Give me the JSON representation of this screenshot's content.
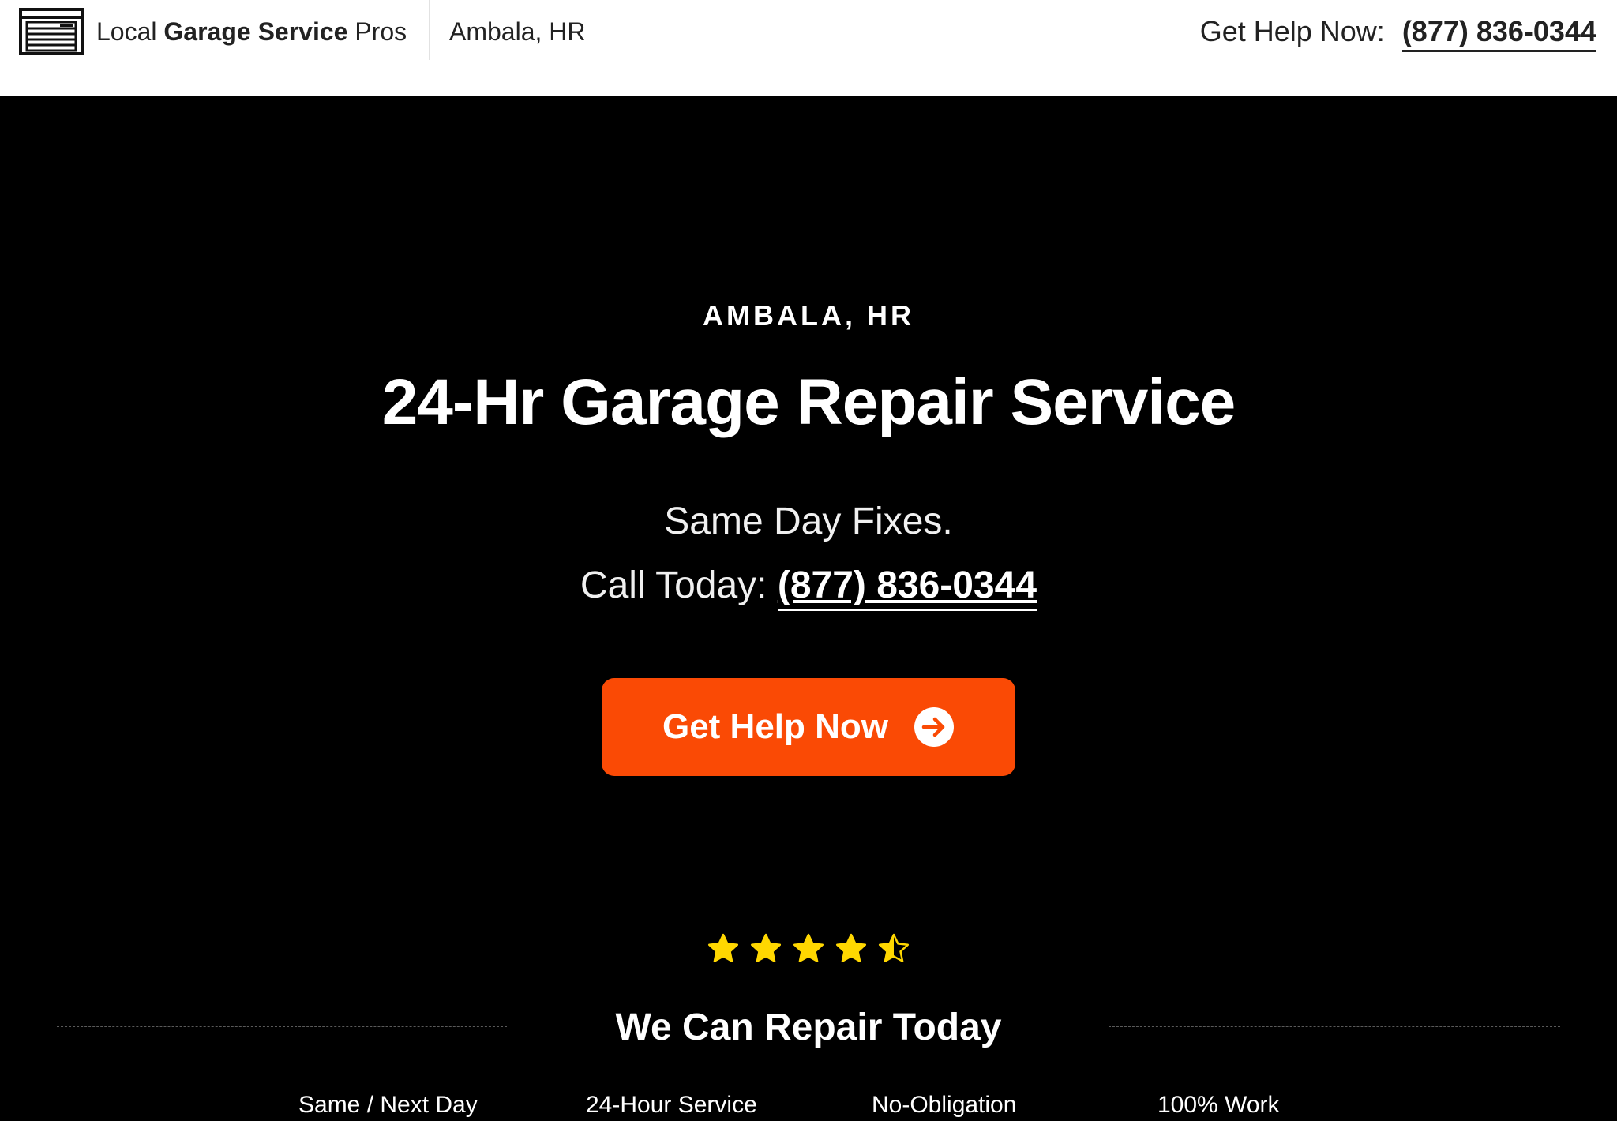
{
  "header": {
    "brand_prefix": "Local",
    "brand_bold": "Garage Service",
    "brand_suffix": "Pros",
    "location": "Ambala, HR",
    "help_label": "Get Help Now:",
    "phone": "(877) 836-0344"
  },
  "hero": {
    "eyebrow": "AMBALA, HR",
    "headline": "24-Hr Garage Repair Service",
    "subline": "Same Day Fixes.",
    "call_label": "Call Today:",
    "call_phone": "(877) 836-0344",
    "cta_label": "Get Help Now",
    "rating": {
      "value": 4.5,
      "max": 5
    },
    "section_title": "We Can Repair Today",
    "features": [
      "Same / Next Day",
      "24-Hour Service",
      "No-Obligation",
      "100% Work"
    ]
  },
  "colors": {
    "accent": "#fa4a05",
    "star": "#ffd700",
    "background": "#000000",
    "header_bg": "#ffffff"
  },
  "icons": {
    "logo": "garage-door-icon",
    "cta": "arrow-circle-right-icon",
    "rating": "star-icon"
  }
}
